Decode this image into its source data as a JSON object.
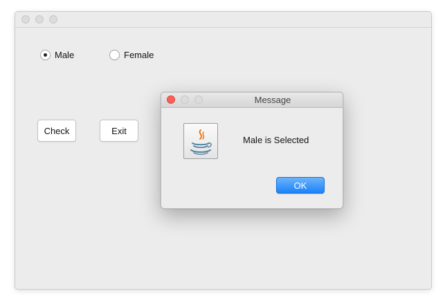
{
  "main_window": {
    "radio_buttons": [
      {
        "label": "Male",
        "selected": true
      },
      {
        "label": "Female",
        "selected": false
      }
    ],
    "buttons": {
      "check_label": "Check",
      "exit_label": "Exit"
    }
  },
  "dialog": {
    "title": "Message",
    "icon": "java-icon",
    "message": "Male is Selected",
    "ok_label": "OK"
  },
  "colors": {
    "window_background": "#ececec",
    "close_button": "#fc5f57",
    "ok_button_accent": "#1a82fb"
  }
}
